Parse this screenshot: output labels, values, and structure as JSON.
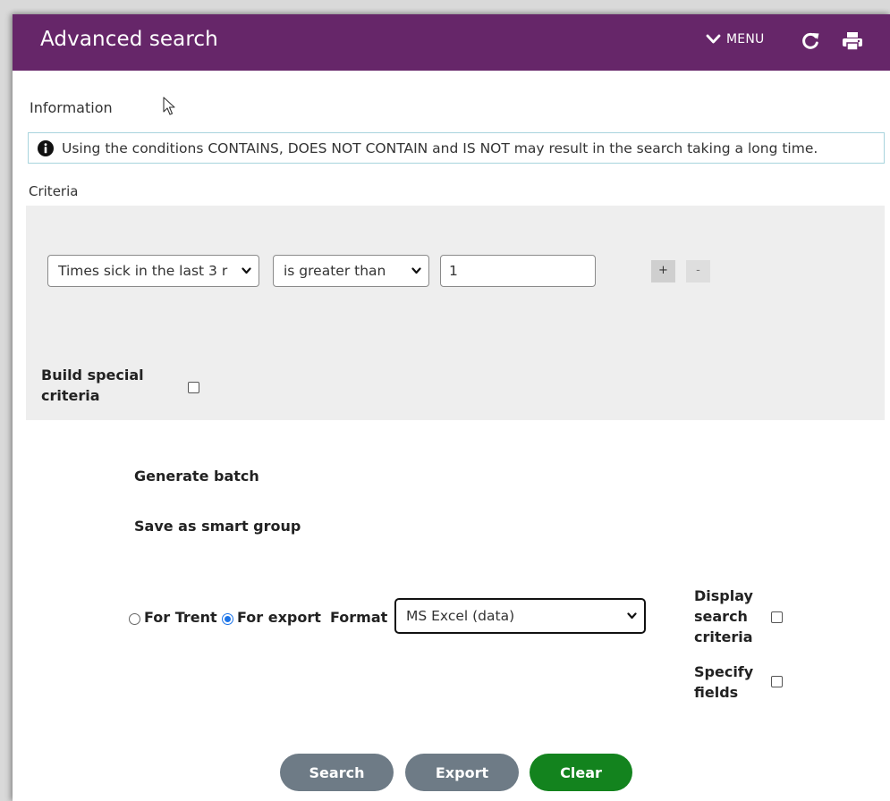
{
  "header": {
    "title": "Advanced search",
    "menu_label": "MENU",
    "bg_color": "#662669"
  },
  "information": {
    "label": "Information",
    "message": "Using the conditions CONTAINS, DOES NOT CONTAIN and IS NOT may result in the search taking a long time."
  },
  "criteria": {
    "label": "Criteria",
    "field_value": "Times sick in the last 3 r",
    "condition_value": "is greater than",
    "value_input": "1",
    "add_label": "+",
    "remove_label": "-",
    "build_special_label": "Build special criteria",
    "build_special_checked": false
  },
  "actions": {
    "generate_batch": "Generate batch",
    "save_smart_group": "Save as smart group"
  },
  "output": {
    "for_trent_label": "For Trent",
    "for_export_label": "For export",
    "selected": "For export",
    "format_label": "Format",
    "format_value": "MS Excel (data)",
    "display_criteria_label": "Display search criteria",
    "display_criteria_checked": false,
    "specify_fields_label": "Specify fields",
    "specify_fields_checked": false
  },
  "buttons": {
    "search": "Search",
    "export": "Export",
    "clear": "Clear",
    "grey_color": "#6e7b86",
    "green_color": "#13831e"
  }
}
